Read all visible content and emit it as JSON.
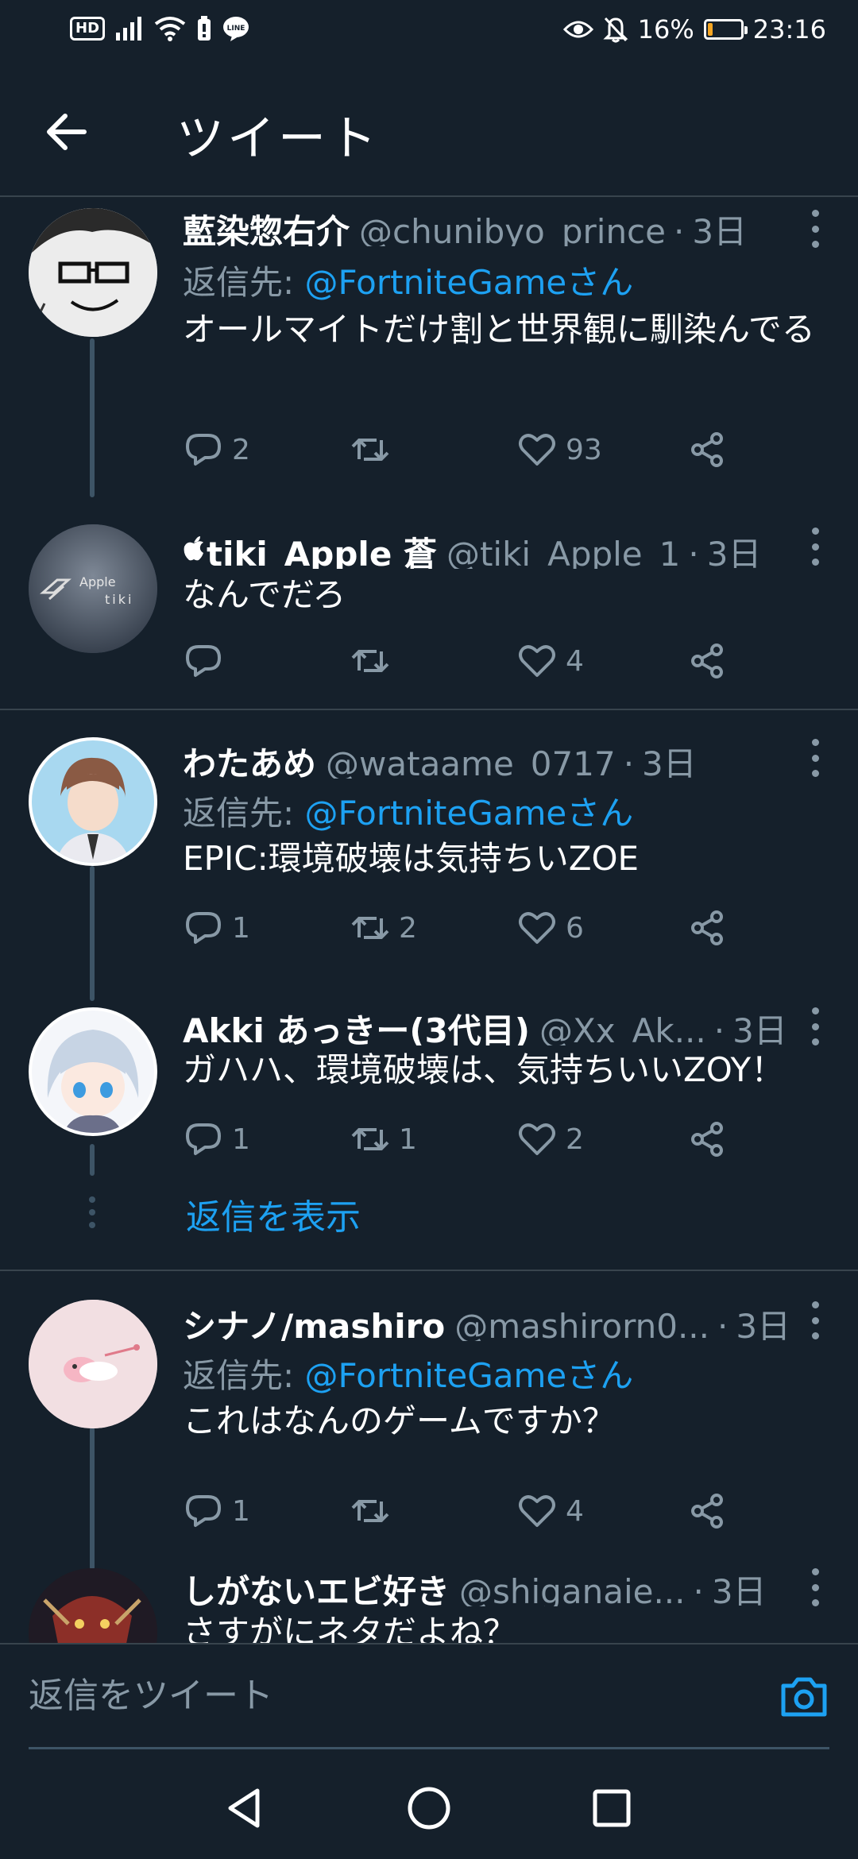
{
  "status_bar": {
    "hd_label": "HD",
    "battery_text": "16%",
    "battery_level": 0.16,
    "time": "23:16",
    "icons": [
      "signal-icon",
      "wifi-icon",
      "battery-saver-icon",
      "line-icon",
      "eye-icon",
      "bell-off-icon"
    ]
  },
  "header": {
    "title": "ツイート"
  },
  "colors": {
    "background": "#15202b",
    "accent": "#1da1f2",
    "muted": "#8899a6",
    "divider": "#38444d"
  },
  "tweets": [
    {
      "name": "藍染惣右介",
      "handle": "@chunibyo_prince",
      "dot": "·",
      "time": "3日",
      "reply_prefix": "返信先: ",
      "reply_to": "@FortniteGameさん",
      "text": "オールマイトだけ割と世界観に馴染んでる",
      "replies": "2",
      "retweets": "",
      "likes": "93"
    },
    {
      "name": "tiki_Apple 蒼",
      "handle": "@tiki_Apple_1",
      "dot": "·",
      "time": "3日",
      "text": "なんでだろ",
      "avatar_text_1": "Apple",
      "avatar_text_2": "tiki",
      "replies": "",
      "retweets": "",
      "likes": "4"
    },
    {
      "name": "わたあめ",
      "handle": "@wataame_0717",
      "dot": "·",
      "time": "3日",
      "reply_prefix": "返信先: ",
      "reply_to": "@FortniteGameさん",
      "text": "EPIC:環境破壊は気持ちいZOE",
      "replies": "1",
      "retweets": "2",
      "likes": "6"
    },
    {
      "name": "Akki あっきー(3代目)",
      "handle": "@Xx_Ak...",
      "dot": "·",
      "time": "3日",
      "text": "ガハハ、環境破壊は、気持ちいいZOY！",
      "replies": "1",
      "retweets": "1",
      "likes": "2"
    },
    {
      "name": "シナノ/mashiro",
      "handle": "@mashirorn0...",
      "dot": "·",
      "time": "3日",
      "reply_prefix": "返信先: ",
      "reply_to": "@FortniteGameさん",
      "text": "これはなんのゲームですか？",
      "replies": "1",
      "retweets": "",
      "likes": "4"
    },
    {
      "name": "しがないエビ好き",
      "handle": "@shiganaie...",
      "dot": "·",
      "time": "3日",
      "text": "さすがにネタだよね？"
    }
  ],
  "show_replies_label": "返信を表示",
  "composer": {
    "placeholder": "返信をツイート"
  }
}
